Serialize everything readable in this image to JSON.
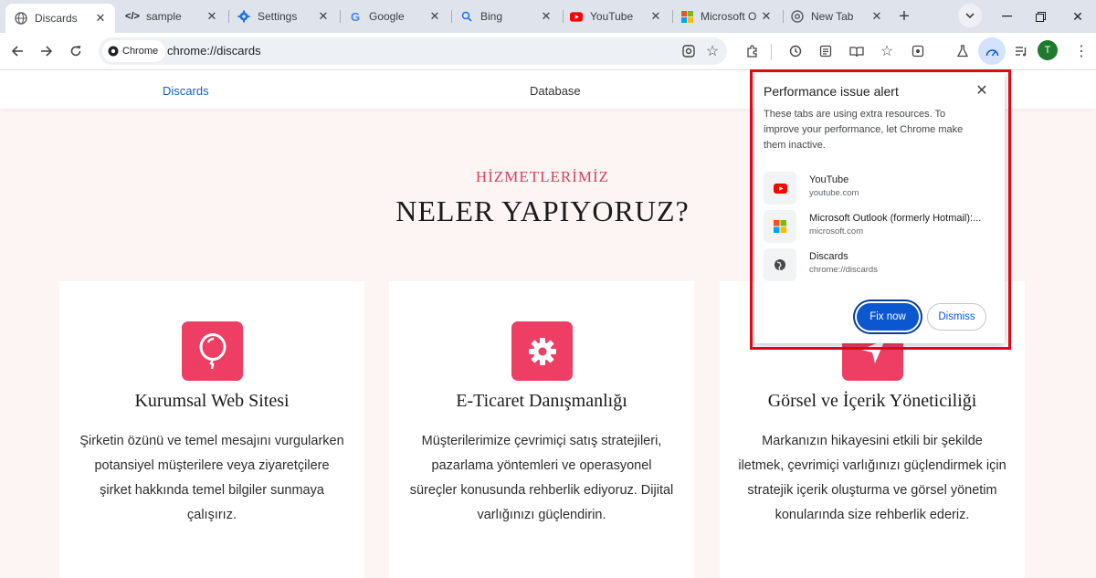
{
  "tabs": [
    {
      "label": "Discards",
      "icon": "globe-icon",
      "active": true
    },
    {
      "label": "sample",
      "icon": "code-icon"
    },
    {
      "label": "Settings",
      "icon": "gear-icon"
    },
    {
      "label": "Google",
      "icon": "google-icon"
    },
    {
      "label": "Bing",
      "icon": "search-icon"
    },
    {
      "label": "YouTube",
      "icon": "youtube-icon"
    },
    {
      "label": "Microsoft O",
      "icon": "microsoft-icon"
    },
    {
      "label": "New Tab",
      "icon": "chrome-icon"
    }
  ],
  "toolbar": {
    "chip_label": "Chrome",
    "url": "chrome://discards",
    "profile_initial": "T"
  },
  "site_nav": {
    "discards": "Discards",
    "database": "Database"
  },
  "hero": {
    "kicker": "HİZMETLERİMİZ",
    "heading": "NELER YAPIYORUZ?"
  },
  "cards": [
    {
      "title": "Kurumsal Web Sitesi",
      "desc": "Şirketin özünü ve temel mesajını vurgularken potansiyel müşterilere veya ziyaretçilere şirket hakkında temel bilgiler sunmaya çalışırız.",
      "icon": "balloon-icon"
    },
    {
      "title": "E-Ticaret Danışmanlığı",
      "desc": "Müşterilerimize çevrimiçi satış stratejileri, pazarlama yöntemleri ve operasyonel süreçler konusunda rehberlik ediyoruz. Dijital varlığınızı güçlendirin.",
      "icon": "gear-icon"
    },
    {
      "title": "Görsel ve İçerik Yöneticiliği",
      "desc": "Markanızın hikayesini etkili bir şekilde iletmek, çevrimiçi varlığınızı güçlendirmek için stratejik içerik oluşturma ve görsel yönetim konularında size rehberlik ederiz.",
      "icon": "send-icon"
    }
  ],
  "popup": {
    "title": "Performance issue alert",
    "body": "These tabs are using extra resources. To improve your performance, let Chrome make them inactive.",
    "items": [
      {
        "title": "YouTube",
        "url": "youtube.com",
        "icon": "youtube-icon"
      },
      {
        "title": "Microsoft Outlook (formerly Hotmail):...",
        "url": "microsoft.com",
        "icon": "microsoft-icon"
      },
      {
        "title": "Discards",
        "url": "chrome://discards",
        "icon": "globe-icon"
      }
    ],
    "fix_label": "Fix now",
    "dismiss_label": "Dismiss"
  },
  "colors": {
    "accent": "#ee3e64",
    "kicker": "#d24462",
    "link_blue": "#1a5fb4",
    "highlight_border": "#e30613",
    "primary_button": "#0b57d0"
  }
}
